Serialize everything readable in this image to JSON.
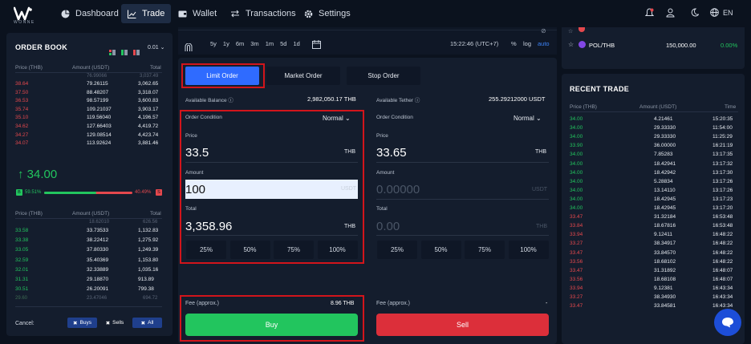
{
  "brand": {
    "name": "WONNE"
  },
  "nav": {
    "items": [
      {
        "label": "Dashboard",
        "icon": "dashboard-icon"
      },
      {
        "label": "Trade",
        "icon": "trade-chart-icon"
      },
      {
        "label": "Wallet",
        "icon": "wallet-icon"
      },
      {
        "label": "Transactions",
        "icon": "transactions-icon"
      },
      {
        "label": "Settings",
        "icon": "gear-icon"
      }
    ],
    "active": "Trade",
    "language": "EN"
  },
  "chart_toolbar": {
    "ranges": [
      "5y",
      "1y",
      "6m",
      "3m",
      "1m",
      "5d",
      "1d"
    ],
    "time": "15:22:46 (UTC+7)",
    "pct": "%",
    "log": "log",
    "auto": "auto"
  },
  "orderbook": {
    "title": "ORDER BOOK",
    "precision": "0.01",
    "headers": {
      "price": "Price (THB)",
      "amount": "Amount (USDT)",
      "total": "Total"
    },
    "asks": [
      {
        "price": "38.64",
        "amount": "79.26115",
        "total": "3,062.65"
      },
      {
        "price": "37.50",
        "amount": "88.48207",
        "total": "3,318.07"
      },
      {
        "price": "36.53",
        "amount": "98.57199",
        "total": "3,600.83"
      },
      {
        "price": "35.74",
        "amount": "109.21037",
        "total": "3,903.17"
      },
      {
        "price": "35.10",
        "amount": "119.56040",
        "total": "4,196.57"
      },
      {
        "price": "34.62",
        "amount": "127.66403",
        "total": "4,419.72"
      },
      {
        "price": "34.27",
        "amount": "129.08514",
        "total": "4,423.74"
      },
      {
        "price": "34.07",
        "amount": "113.92624",
        "total": "3,881.46"
      }
    ],
    "last_price": "34.00",
    "buy_pct": "59.51%",
    "sell_pct": "40.49%",
    "buy_tag": "B",
    "sell_tag": "S",
    "bids": [
      {
        "price": "33.58",
        "amount": "33.73533",
        "total": "1,132.83"
      },
      {
        "price": "33.38",
        "amount": "38.22412",
        "total": "1,275.92"
      },
      {
        "price": "33.05",
        "amount": "37.80330",
        "total": "1,249.39"
      },
      {
        "price": "32.59",
        "amount": "35.40369",
        "total": "1,153.80"
      },
      {
        "price": "32.01",
        "amount": "32.33889",
        "total": "1,035.16"
      },
      {
        "price": "31.31",
        "amount": "29.18870",
        "total": "913.89"
      },
      {
        "price": "30.51",
        "amount": "26.20091",
        "total": "799.38"
      }
    ],
    "cancel_label": "Cancel:",
    "cancel_buttons": [
      "Buys",
      "Sells",
      "All"
    ]
  },
  "order_form": {
    "tabs": [
      "Limit Order",
      "Market Order",
      "Stop Order"
    ],
    "buy": {
      "available_label": "Available Balance",
      "available_value": "2,982,050.17 THB",
      "condition_label": "Order Condition",
      "condition_value": "Normal",
      "price_label": "Price",
      "price_value": "33.5",
      "price_unit": "THB",
      "amount_label": "Amount",
      "amount_value": "100",
      "amount_unit": "USDT",
      "total_label": "Total",
      "total_value": "3,358.96",
      "total_unit": "THB",
      "fee_label": "Fee (approx.)",
      "fee_value": "8.96 THB",
      "submit": "Buy"
    },
    "sell": {
      "available_label": "Available Tether",
      "available_value": "255.29212000 USDT",
      "condition_label": "Order Condition",
      "condition_value": "Normal",
      "price_label": "Price",
      "price_value": "33.65",
      "price_unit": "THB",
      "amount_label": "Amount",
      "amount_placeholder": "0.00000",
      "amount_unit": "USDT",
      "total_label": "Total",
      "total_placeholder": "0.00",
      "total_unit": "THB",
      "fee_label": "Fee (approx.)",
      "fee_value": "-",
      "submit": "Sell"
    },
    "percentages": [
      "25%",
      "50%",
      "75%",
      "100%"
    ]
  },
  "watchlist": {
    "row": {
      "pair": "POL/THB",
      "volume": "150,000.00",
      "change": "0.00%"
    }
  },
  "recent_trades": {
    "title": "RECENT TRADE",
    "headers": {
      "price": "Price (THB)",
      "amount": "Amount (USDT)",
      "time": "Time"
    },
    "rows": [
      {
        "side": "buy",
        "price": "34.00",
        "amount": "4.21461",
        "time": "15:20:35"
      },
      {
        "side": "buy",
        "price": "34.00",
        "amount": "29.33330",
        "time": "11:54:00"
      },
      {
        "side": "buy",
        "price": "34.00",
        "amount": "29.33330",
        "time": "11:25:29"
      },
      {
        "side": "buy",
        "price": "33.90",
        "amount": "36.00000",
        "time": "16:21:19"
      },
      {
        "side": "buy",
        "price": "34.00",
        "amount": "7.85283",
        "time": "13:17:35"
      },
      {
        "side": "buy",
        "price": "34.00",
        "amount": "18.42941",
        "time": "13:17:32"
      },
      {
        "side": "buy",
        "price": "34.00",
        "amount": "18.42942",
        "time": "13:17:30"
      },
      {
        "side": "buy",
        "price": "34.00",
        "amount": "5.28834",
        "time": "13:17:26"
      },
      {
        "side": "buy",
        "price": "34.00",
        "amount": "13.14110",
        "time": "13:17:26"
      },
      {
        "side": "buy",
        "price": "34.00",
        "amount": "18.42945",
        "time": "13:17:23"
      },
      {
        "side": "buy",
        "price": "34.00",
        "amount": "18.42945",
        "time": "13:17:20"
      },
      {
        "side": "sell",
        "price": "33.47",
        "amount": "31.32184",
        "time": "16:53:48"
      },
      {
        "side": "sell",
        "price": "33.84",
        "amount": "18.67816",
        "time": "16:53:48"
      },
      {
        "side": "sell",
        "price": "33.94",
        "amount": "9.12411",
        "time": "16:48:22"
      },
      {
        "side": "sell",
        "price": "33.27",
        "amount": "38.34917",
        "time": "16:48:22"
      },
      {
        "side": "sell",
        "price": "33.47",
        "amount": "33.84570",
        "time": "16:48:22"
      },
      {
        "side": "sell",
        "price": "33.56",
        "amount": "18.68102",
        "time": "16:48:22"
      },
      {
        "side": "sell",
        "price": "33.47",
        "amount": "31.31892",
        "time": "16:48:07"
      },
      {
        "side": "sell",
        "price": "33.56",
        "amount": "18.68108",
        "time": "16:48:07"
      },
      {
        "side": "sell",
        "price": "33.94",
        "amount": "9.12381",
        "time": "16:43:34"
      },
      {
        "side": "sell",
        "price": "33.27",
        "amount": "38.34930",
        "time": "16:43:34"
      },
      {
        "side": "sell",
        "price": "33.47",
        "amount": "33.84581",
        "time": "16:43:34"
      }
    ]
  },
  "colors": {
    "buy": "#22c55e",
    "sell": "#e5484d",
    "accent": "#2f6bff",
    "highlight": "#d2151b"
  }
}
